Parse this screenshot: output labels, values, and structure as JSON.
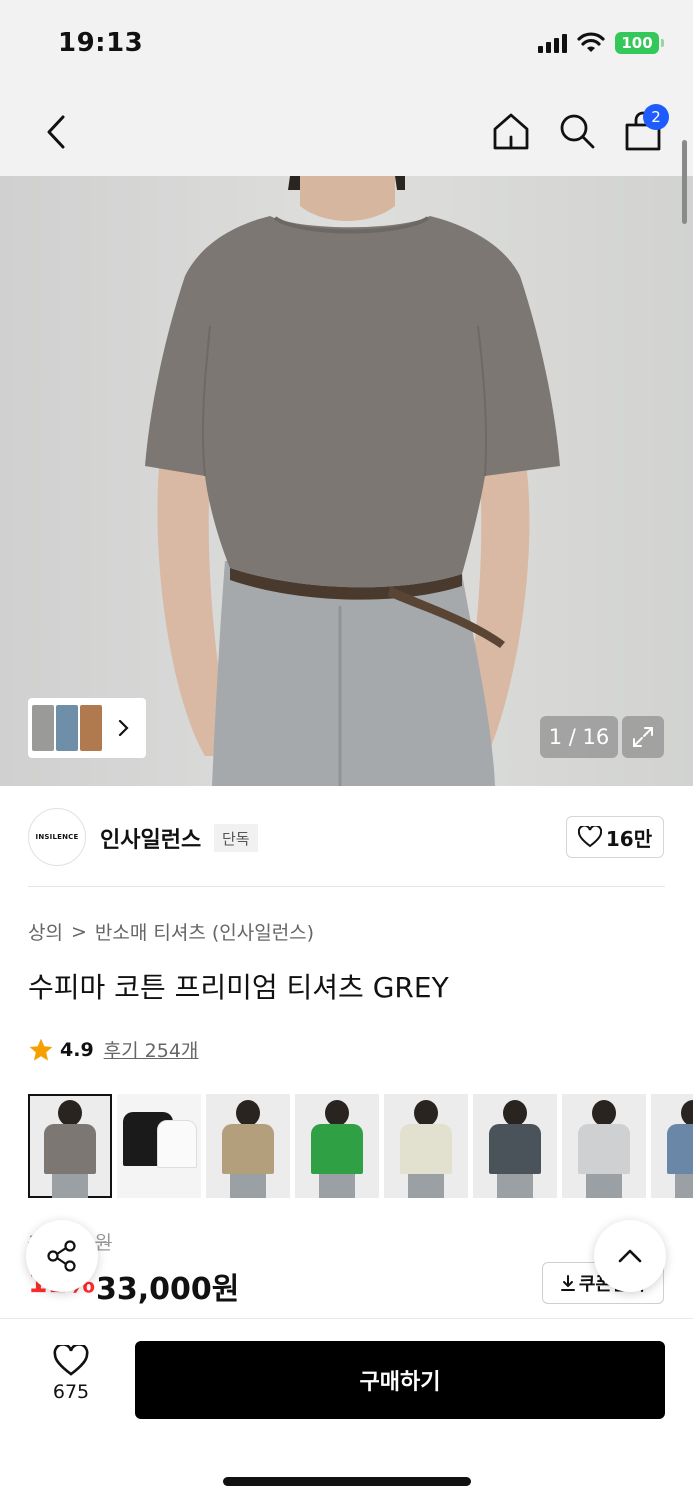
{
  "status_bar": {
    "time": "19:13",
    "battery": "100"
  },
  "nav": {
    "cart_count": "2"
  },
  "hero": {
    "counter": "1 / 16"
  },
  "brand": {
    "logo_text": "INSILENCE",
    "name": "인사일런스",
    "tag": "단독",
    "likes": "16만"
  },
  "breadcrumb": {
    "category": "상의",
    "separator": ">",
    "subcategory": "반소매 티셔츠 (인사일런스)"
  },
  "product": {
    "title": "수피마 코튼 프리미엄 티셔츠 GREY",
    "rating": "4.9",
    "reviews": "후기 254개"
  },
  "swatch_colors": [
    "#7d7773",
    "#1a1a1a",
    "#b39f7c",
    "#2fa043",
    "#e2e0cf",
    "#4a525a",
    "#cfd0d2",
    "#6a87a8"
  ],
  "price": {
    "original": "37,000원",
    "discount": "11%",
    "current": "33,000원",
    "coupon": "쿠폰받기"
  },
  "bottom": {
    "wish_count": "675",
    "buy_label": "구매하기"
  },
  "colors": {
    "accent_blue": "#1f5cff",
    "discount_red": "#ff2b2b",
    "buy_button": "#000000",
    "battery_green": "#34c759"
  }
}
